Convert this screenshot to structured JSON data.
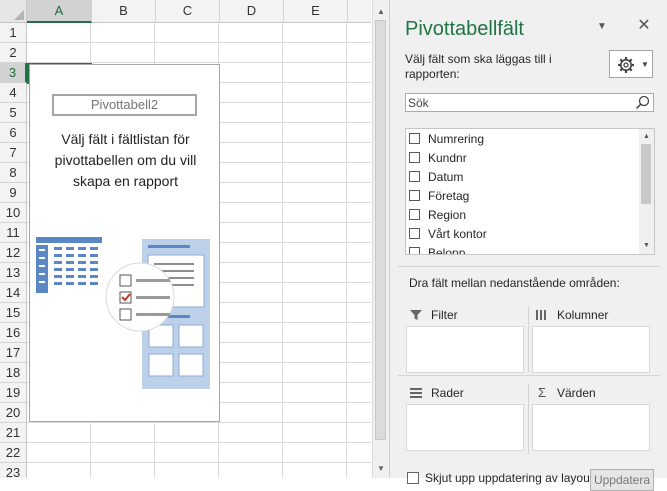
{
  "sheet": {
    "columns": [
      "A",
      "B",
      "C",
      "D",
      "E"
    ],
    "rows": [
      "1",
      "2",
      "3",
      "4",
      "5",
      "6",
      "7",
      "8",
      "9",
      "10",
      "11",
      "12",
      "13",
      "14",
      "15",
      "16",
      "17",
      "18",
      "19",
      "20",
      "21",
      "22",
      "23"
    ],
    "active_column": "A",
    "active_row": "3",
    "pivot_placeholder": {
      "name": "Pivottabell2",
      "message": "Välj fält i fältlistan för pivottabellen om du vill skapa en rapport"
    }
  },
  "pane": {
    "title": "Pivottabellfält",
    "instruction": "Välj fält som ska läggas till i rapporten:",
    "search_placeholder": "Sök",
    "fields": [
      "Numrering",
      "Kundnr",
      "Datum",
      "Företag",
      "Region",
      "Vårt kontor",
      "Belopp"
    ],
    "drag_instruction": "Dra fält mellan nedanstående områden:",
    "areas": {
      "filter": "Filter",
      "columns": "Kolumner",
      "rows": "Rader",
      "values": "Värden"
    },
    "defer_label": "Skjut upp uppdatering av layout",
    "update_button": "Uppdatera"
  },
  "colors": {
    "accent": "#217346",
    "pane_bg": "#f0f0f0",
    "illustration_blue": "#5b87c5"
  }
}
